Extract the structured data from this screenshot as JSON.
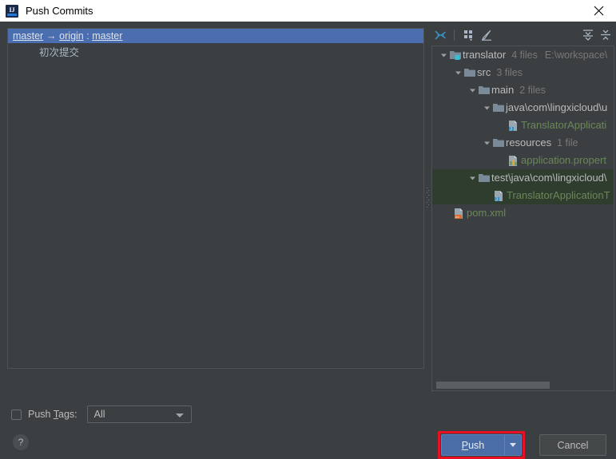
{
  "window": {
    "title": "Push Commits",
    "app_icon": "intellij-idea-icon",
    "close_icon": "close-icon"
  },
  "commits_panel": {
    "branch_row": {
      "source": "master",
      "arrow": "→",
      "remote": "origin",
      "separator": ":",
      "target": "master"
    },
    "commits": [
      {
        "message": "初次提交"
      }
    ]
  },
  "tree_toolbar": {
    "buttons": [
      {
        "name": "expand-arrows-icon",
        "label": ""
      },
      {
        "name": "group-by-icon",
        "label": ""
      },
      {
        "name": "edit-pencil-icon",
        "label": ""
      },
      {
        "name": "expand-all-icon",
        "label": ""
      },
      {
        "name": "collapse-all-icon",
        "label": ""
      }
    ]
  },
  "file_tree": {
    "nodes": [
      {
        "label": "translator",
        "count": "4 files",
        "path": "E:\\workspace\\",
        "icon": "module-folder-icon",
        "indent": 0,
        "expanded": true,
        "color": "normal",
        "highlight": false
      },
      {
        "label": "src",
        "count": "3 files",
        "path": "",
        "icon": "folder-icon",
        "indent": 1,
        "expanded": true,
        "color": "normal",
        "highlight": false
      },
      {
        "label": "main",
        "count": "2 files",
        "path": "",
        "icon": "folder-icon",
        "indent": 2,
        "expanded": true,
        "color": "normal",
        "highlight": false
      },
      {
        "label": "java\\com\\lingxicloud\\u",
        "count": "",
        "path": "",
        "icon": "folder-icon",
        "indent": 3,
        "expanded": true,
        "color": "normal",
        "highlight": false
      },
      {
        "label": "TranslatorApplicati",
        "count": "",
        "path": "",
        "icon": "java-file-icon",
        "indent": 4,
        "expanded": false,
        "color": "green",
        "highlight": false
      },
      {
        "label": "resources",
        "count": "1 file",
        "path": "",
        "icon": "folder-icon",
        "indent": 3,
        "expanded": true,
        "color": "normal",
        "highlight": false
      },
      {
        "label": "application.propert",
        "count": "",
        "path": "",
        "icon": "properties-file-icon",
        "indent": 4,
        "expanded": false,
        "color": "green",
        "highlight": false
      },
      {
        "label": "test\\java\\com\\lingxicloud\\",
        "count": "",
        "path": "",
        "icon": "folder-icon",
        "indent": 2,
        "expanded": true,
        "color": "normal",
        "highlight": true
      },
      {
        "label": "TranslatorApplicationT",
        "count": "",
        "path": "",
        "icon": "java-file-icon",
        "indent": 3,
        "expanded": false,
        "color": "green",
        "highlight": true
      },
      {
        "label": "pom.xml",
        "count": "",
        "path": "",
        "icon": "xml-file-icon",
        "indent": 1,
        "expanded": false,
        "color": "green",
        "highlight": false
      }
    ],
    "hscrollbar": "horizontal-scrollbar"
  },
  "options": {
    "push_tags_checked": false,
    "push_tags_label_pre": "Push ",
    "push_tags_label_mnemonic": "T",
    "push_tags_label_post": "ags:",
    "tags_select_value": "All"
  },
  "footer": {
    "help_label": "?",
    "push_label_pre": "",
    "push_label_mnemonic": "P",
    "push_label_post": "ush",
    "cancel_label": "Cancel",
    "push_highlight_color": "#e81123"
  },
  "colors": {
    "dialog_bg": "#3c3f41",
    "selection_blue": "#4a6eb0",
    "tree_highlight_green": "#2f3d2f",
    "file_text_green": "#6a8759",
    "accent_blue": "#4a6da7"
  }
}
